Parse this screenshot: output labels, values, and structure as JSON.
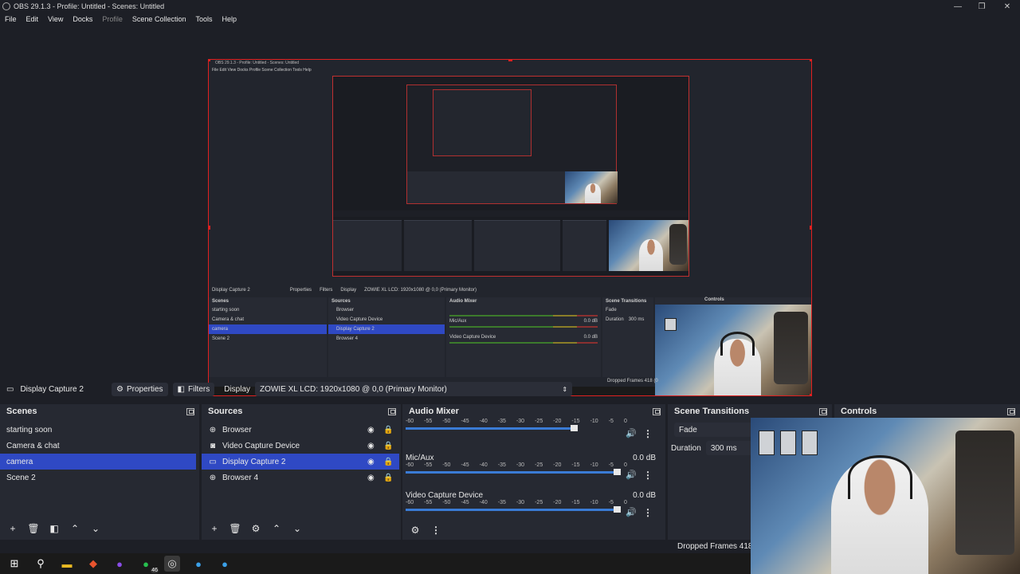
{
  "window": {
    "title": "OBS 29.1.3 - Profile: Untitled - Scenes: Untitled",
    "minimize": "—",
    "maximize": "❐",
    "close": "✕"
  },
  "menu": [
    "File",
    "Edit",
    "View",
    "Docks",
    "Profile",
    "Scene Collection",
    "Tools",
    "Help"
  ],
  "nested_preview": {
    "title": "OBS 29.1.3 - Profile: Untitled - Scenes: Untitled",
    "menu": "File  Edit  View  Docks  Profile  Scene Collection  Tools  Help",
    "context_source": "Display Capture 2",
    "context_properties": "Properties",
    "context_filters": "Filters",
    "context_display": "Display",
    "context_monitor": "ZOWIE XL LCD: 1920x1080 @ 0,0 (Primary Monitor)",
    "scenes_header": "Scenes",
    "sources_header": "Sources",
    "mixer_header": "Audio Mixer",
    "transitions_header": "Scene Transitions",
    "controls_header": "Controls",
    "scenes": [
      "starting soon",
      "Camera & chat",
      "camera",
      "Scene 2"
    ],
    "sources": [
      "Browser",
      "Video Capture Device",
      "Display Capture 2",
      "Browser 4"
    ],
    "mic_label": "Mic/Aux",
    "video_label": "Video Capture Device",
    "db": "0.0 dB",
    "fade": "Fade",
    "duration_label": "Duration",
    "duration_value": "300 ms",
    "dropped": "Dropped Frames 418 (0"
  },
  "context_bar": {
    "source_name": "Display Capture 2",
    "properties_label": "Properties",
    "filters_label": "Filters",
    "display_label": "Display",
    "display_value": "ZOWIE XL LCD: 1920x1080 @ 0,0 (Primary Monitor)"
  },
  "scenes": {
    "header": "Scenes",
    "items": [
      {
        "label": "starting soon",
        "selected": false
      },
      {
        "label": "Camera & chat",
        "selected": false
      },
      {
        "label": "camera",
        "selected": true
      },
      {
        "label": "Scene 2",
        "selected": false
      }
    ]
  },
  "sources": {
    "header": "Sources",
    "items": [
      {
        "label": "Browser",
        "icon": "globe-icon",
        "selected": false
      },
      {
        "label": "Video Capture Device",
        "icon": "camera-icon",
        "selected": false
      },
      {
        "label": "Display Capture 2",
        "icon": "monitor-icon",
        "selected": true
      },
      {
        "label": "Browser 4",
        "icon": "globe-icon",
        "selected": false
      }
    ]
  },
  "audio_mixer": {
    "header": "Audio Mixer",
    "scale": [
      "-60",
      "-55",
      "-50",
      "-45",
      "-40",
      "-35",
      "-30",
      "-25",
      "-20",
      "-15",
      "-10",
      "-5",
      "0"
    ],
    "channels": [
      {
        "name": "",
        "db": "",
        "volume": 0.8
      },
      {
        "name": "Mic/Aux",
        "db": "0.0 dB",
        "volume": 1.0
      },
      {
        "name": "Video Capture Device",
        "db": "0.0 dB",
        "volume": 1.0
      }
    ]
  },
  "transitions": {
    "header": "Scene Transitions",
    "type": "Fade",
    "duration_label": "Duration",
    "duration_value": "300 ms"
  },
  "controls": {
    "header": "Controls"
  },
  "status": {
    "dropped_frames": "Dropped Frames 418 (0"
  },
  "taskbar": {
    "badge": "46"
  },
  "colors": {
    "selection": "#2f49c4",
    "preview_border": "#e02020",
    "background": "#1d1f26",
    "panel": "#262932"
  }
}
